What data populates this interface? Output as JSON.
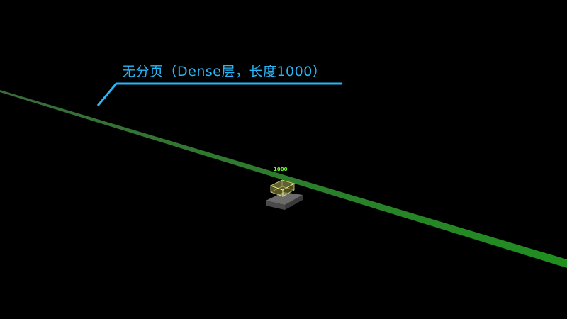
{
  "callout": {
    "label": "无分页（Dense层，长度1000）"
  },
  "layer": {
    "length_label": "1000"
  },
  "colors": {
    "background": "#000000",
    "callout": "#29b6f6",
    "sequence_line": "#2e8b2e",
    "layer_label": "#66ff33",
    "layer_box_fill": "#d6d66e",
    "layer_box_stroke": "#ffff99",
    "base_top": "#6b6b6b",
    "base_side": "#4a4a4a"
  }
}
